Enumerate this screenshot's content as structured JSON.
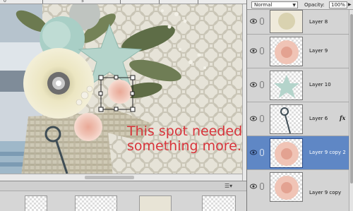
{
  "canvas": {
    "ruler_labels": [
      "0",
      "5"
    ],
    "note_text": [
      "This spot needed",
      "something more."
    ]
  },
  "layers_panel": {
    "blend_mode": "Normal",
    "opacity_label": "Opacity:",
    "opacity_value": "100%",
    "layers": [
      {
        "name": "Layer 8"
      },
      {
        "name": "Layer 9"
      },
      {
        "name": "Layer 10"
      },
      {
        "name": "Layer 6",
        "fx": "fx"
      },
      {
        "name": "Layer 9 copy 2",
        "selected": true
      },
      {
        "name": "Layer 9 copy"
      }
    ]
  },
  "colors": {
    "note_text": "#d8343b",
    "selection": "#5f87c5"
  },
  "icons": [
    "visibility-eye-icon",
    "link-icon",
    "fx-icon",
    "dropdown-arrow-icon",
    "bin-menu-icon"
  ]
}
